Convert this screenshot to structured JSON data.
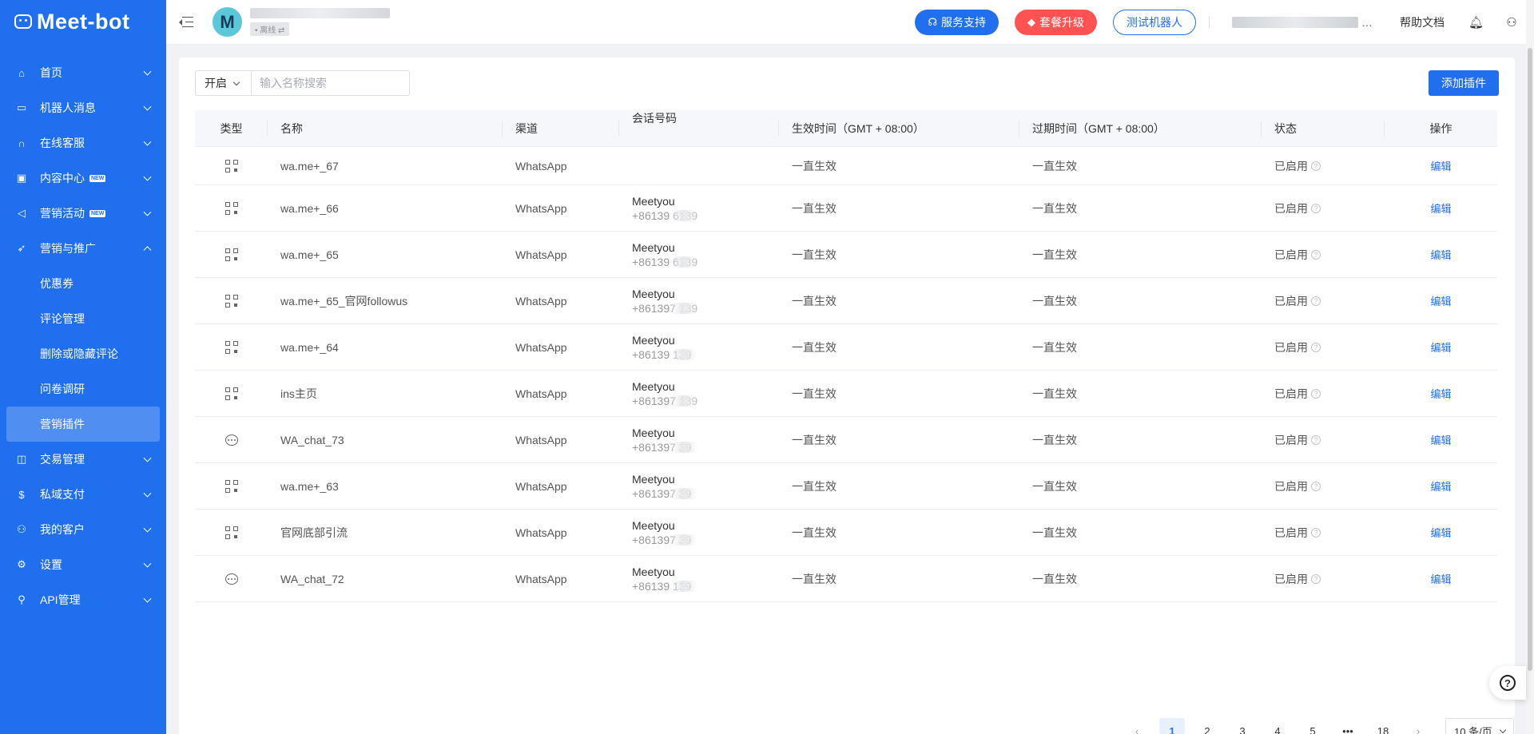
{
  "brand": {
    "name": "Meet-bot"
  },
  "sidebar": {
    "items": [
      {
        "label": "首页",
        "icon": "home-icon",
        "glyph": "⌂",
        "expand": "down"
      },
      {
        "label": "机器人消息",
        "icon": "message-icon",
        "glyph": "▭",
        "expand": "down"
      },
      {
        "label": "在线客服",
        "icon": "headset-icon",
        "glyph": "∩",
        "expand": "down"
      },
      {
        "label": "内容中心",
        "icon": "content-icon",
        "glyph": "▣",
        "expand": "down",
        "badge": "NEW"
      },
      {
        "label": "营销活动",
        "icon": "megaphone-icon",
        "glyph": "◁",
        "expand": "down",
        "badge": "NEW"
      },
      {
        "label": "营销与推广",
        "icon": "send-icon",
        "glyph": "➶",
        "expand": "up"
      }
    ],
    "sub_items": [
      {
        "label": "优惠券"
      },
      {
        "label": "评论管理"
      },
      {
        "label": "删除或隐藏评论"
      },
      {
        "label": "问卷调研"
      },
      {
        "label": "营销插件",
        "active": true
      }
    ],
    "items_after": [
      {
        "label": "交易管理",
        "icon": "bag-icon",
        "glyph": "◫",
        "expand": "down"
      },
      {
        "label": "私域支付",
        "icon": "dollar-icon",
        "glyph": "$",
        "expand": "down"
      },
      {
        "label": "我的客户",
        "icon": "customers-icon",
        "glyph": "⚇",
        "expand": "down"
      },
      {
        "label": "设置",
        "icon": "settings-icon",
        "glyph": "⚙",
        "expand": "down"
      },
      {
        "label": "API管理",
        "icon": "api-icon",
        "glyph": "⚲",
        "expand": "down"
      }
    ]
  },
  "header": {
    "avatar_letter": "M",
    "status": "• 离线 ⇄",
    "support_button": "服务支持",
    "upgrade_button": "套餐升级",
    "test_bot_button": "测试机器人",
    "more": "…",
    "help_docs": "帮助文档"
  },
  "toolbar": {
    "filter_value": "开启",
    "search_placeholder": "输入名称搜索",
    "add_button": "添加插件"
  },
  "table": {
    "columns": [
      "类型",
      "名称",
      "渠道",
      "会话号码",
      "生效时间（GMT + 08:00）",
      "过期时间（GMT + 08:00）",
      "状态",
      "操作"
    ],
    "rows": [
      {
        "type": "qr",
        "name": "wa.me+_67",
        "channel": "WhatsApp",
        "conv_name": "",
        "conv_phone": "",
        "start": "一直生效",
        "expire": "一直生效",
        "status": "已启用",
        "action": "编辑"
      },
      {
        "type": "qr",
        "name": "wa.me+_66",
        "channel": "WhatsApp",
        "conv_name": "Meetyou",
        "conv_phone": "+86139    6139",
        "start": "一直生效",
        "expire": "一直生效",
        "status": "已启用",
        "action": "编辑"
      },
      {
        "type": "qr",
        "name": "wa.me+_65",
        "channel": "WhatsApp",
        "conv_name": "Meetyou",
        "conv_phone": "+86139    6139",
        "start": "一直生效",
        "expire": "一直生效",
        "status": "已启用",
        "action": "编辑"
      },
      {
        "type": "qr",
        "name": "wa.me+_65_官网followus",
        "channel": "WhatsApp",
        "conv_name": "Meetyou",
        "conv_phone": "+861397    139",
        "start": "一直生效",
        "expire": "一直生效",
        "status": "已启用",
        "action": "编辑"
      },
      {
        "type": "qr",
        "name": "wa.me+_64",
        "channel": "WhatsApp",
        "conv_name": "Meetyou",
        "conv_phone": "+86139    139",
        "start": "一直生效",
        "expire": "一直生效",
        "status": "已启用",
        "action": "编辑"
      },
      {
        "type": "qr",
        "name": "ins主页",
        "channel": "WhatsApp",
        "conv_name": "Meetyou",
        "conv_phone": "+861397    139",
        "start": "一直生效",
        "expire": "一直生效",
        "status": "已启用",
        "action": "编辑"
      },
      {
        "type": "chat",
        "name": "WA_chat_73",
        "channel": "WhatsApp",
        "conv_name": "Meetyou",
        "conv_phone": "+861397    39",
        "start": "一直生效",
        "expire": "一直生效",
        "status": "已启用",
        "action": "编辑"
      },
      {
        "type": "qr",
        "name": "wa.me+_63",
        "channel": "WhatsApp",
        "conv_name": "Meetyou",
        "conv_phone": "+861397    39",
        "start": "一直生效",
        "expire": "一直生效",
        "status": "已启用",
        "action": "编辑"
      },
      {
        "type": "qr",
        "name": "官网底部引流",
        "channel": "WhatsApp",
        "conv_name": "Meetyou",
        "conv_phone": "+861397    39",
        "start": "一直生效",
        "expire": "一直生效",
        "status": "已启用",
        "action": "编辑"
      },
      {
        "type": "chat",
        "name": "WA_chat_72",
        "channel": "WhatsApp",
        "conv_name": "Meetyou",
        "conv_phone": "+86139    139",
        "start": "一直生效",
        "expire": "一直生效",
        "status": "已启用",
        "action": "编辑"
      }
    ]
  },
  "pagination": {
    "prev": "‹",
    "pages": [
      "1",
      "2",
      "3",
      "4",
      "5",
      "•••",
      "18"
    ],
    "current": "1",
    "next": "›",
    "per_page": "10 条/页"
  },
  "colors": {
    "primary": "#1f6fee",
    "danger": "#ff5353"
  }
}
